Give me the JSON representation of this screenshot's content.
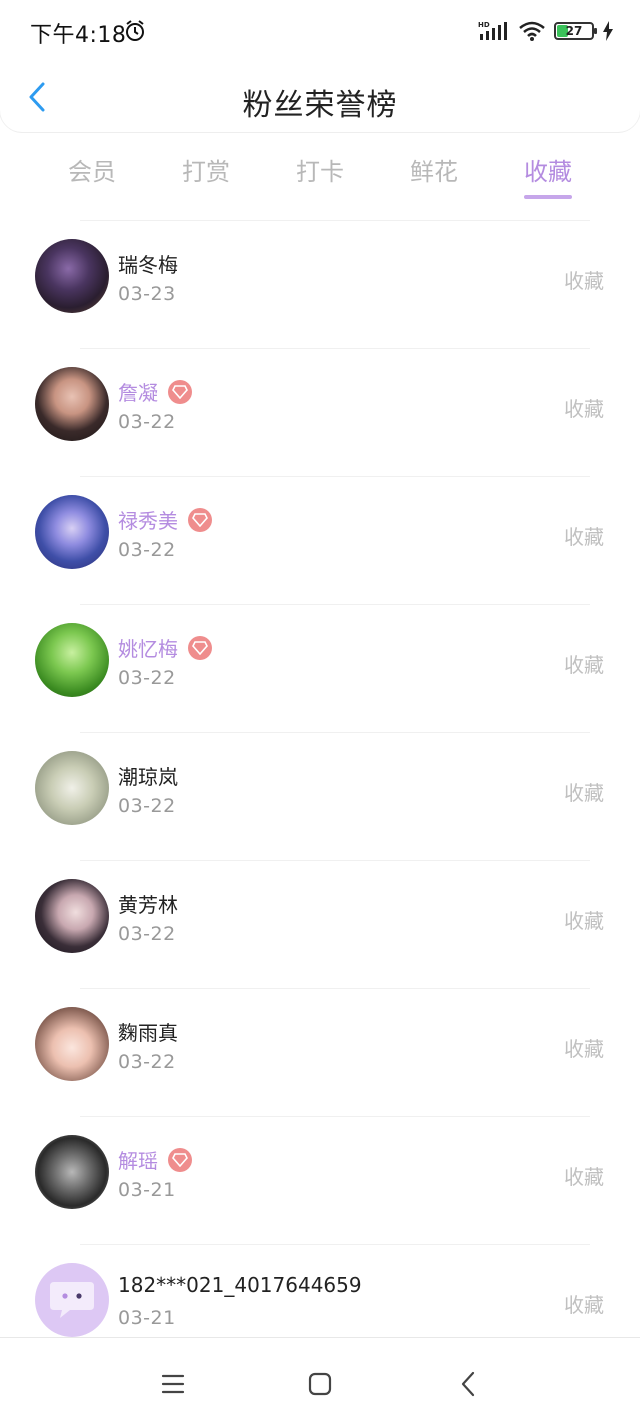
{
  "status_bar": {
    "time": "下午4:18",
    "network": "HD",
    "battery_level": "27"
  },
  "header": {
    "title": "粉丝荣誉榜"
  },
  "tabs": [
    {
      "label": "会员",
      "active": false
    },
    {
      "label": "打赏",
      "active": false
    },
    {
      "label": "打卡",
      "active": false
    },
    {
      "label": "鲜花",
      "active": false
    },
    {
      "label": "收藏",
      "active": true
    }
  ],
  "fans": [
    {
      "name": "瑞冬梅",
      "date": "03-23",
      "vip": false,
      "action": "收藏"
    },
    {
      "name": "詹凝",
      "date": "03-22",
      "vip": true,
      "action": "收藏"
    },
    {
      "name": "禄秀美",
      "date": "03-22",
      "vip": true,
      "action": "收藏"
    },
    {
      "name": "姚忆梅",
      "date": "03-22",
      "vip": true,
      "action": "收藏"
    },
    {
      "name": "潮琼岚",
      "date": "03-22",
      "vip": false,
      "action": "收藏"
    },
    {
      "name": "黄芳林",
      "date": "03-22",
      "vip": false,
      "action": "收藏"
    },
    {
      "name": "麴雨真",
      "date": "03-22",
      "vip": false,
      "action": "收藏"
    },
    {
      "name": "解瑶",
      "date": "03-21",
      "vip": true,
      "action": "收藏"
    },
    {
      "name": "182***021_4017644659",
      "date": "03-21",
      "vip": false,
      "action": "收藏"
    }
  ],
  "colors": {
    "accent": "#b48ce0",
    "vip_badge": "#ef8d8d",
    "back_arrow": "#2d9bf0"
  }
}
